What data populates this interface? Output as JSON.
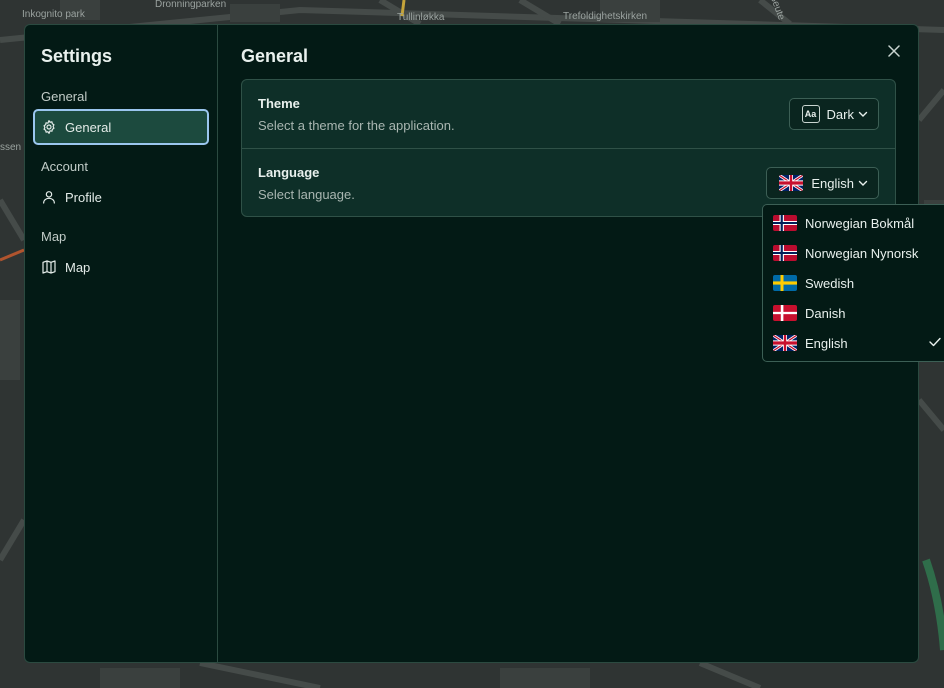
{
  "map": {
    "labels": [
      "Inkognito park",
      "Dronningparken",
      "Tullinløkka",
      "Trefoldighetskirken",
      "ssen",
      "Seute"
    ]
  },
  "sidebar": {
    "title": "Settings",
    "groups": [
      {
        "label": "General",
        "items": [
          {
            "label": "General",
            "icon": "gear-icon",
            "active": true
          }
        ]
      },
      {
        "label": "Account",
        "items": [
          {
            "label": "Profile",
            "icon": "user-icon",
            "active": false
          }
        ]
      },
      {
        "label": "Map",
        "items": [
          {
            "label": "Map",
            "icon": "map-icon",
            "active": false
          }
        ]
      }
    ]
  },
  "main": {
    "title": "General",
    "settings": {
      "theme": {
        "title": "Theme",
        "description": "Select a theme for the application.",
        "value": "Dark",
        "icon_text": "Aa"
      },
      "language": {
        "title": "Language",
        "description": "Select language.",
        "value": "English"
      }
    }
  },
  "language_dropdown": {
    "options": [
      {
        "label": "Norwegian Bokmål",
        "flag": "norway-flag-icon",
        "selected": false
      },
      {
        "label": "Norwegian Nynorsk",
        "flag": "norway-flag-icon",
        "selected": false
      },
      {
        "label": "Swedish",
        "flag": "sweden-flag-icon",
        "selected": false
      },
      {
        "label": "Danish",
        "flag": "denmark-flag-icon",
        "selected": false
      },
      {
        "label": "English",
        "flag": "uk-flag-icon",
        "selected": true
      }
    ]
  },
  "colors": {
    "dialog_bg": "#031a15",
    "card_bg": "#0e2f28",
    "active_nav_bg": "#1c4a3e",
    "focus_ring": "#9bc6ee",
    "border": "#2b4a40"
  }
}
